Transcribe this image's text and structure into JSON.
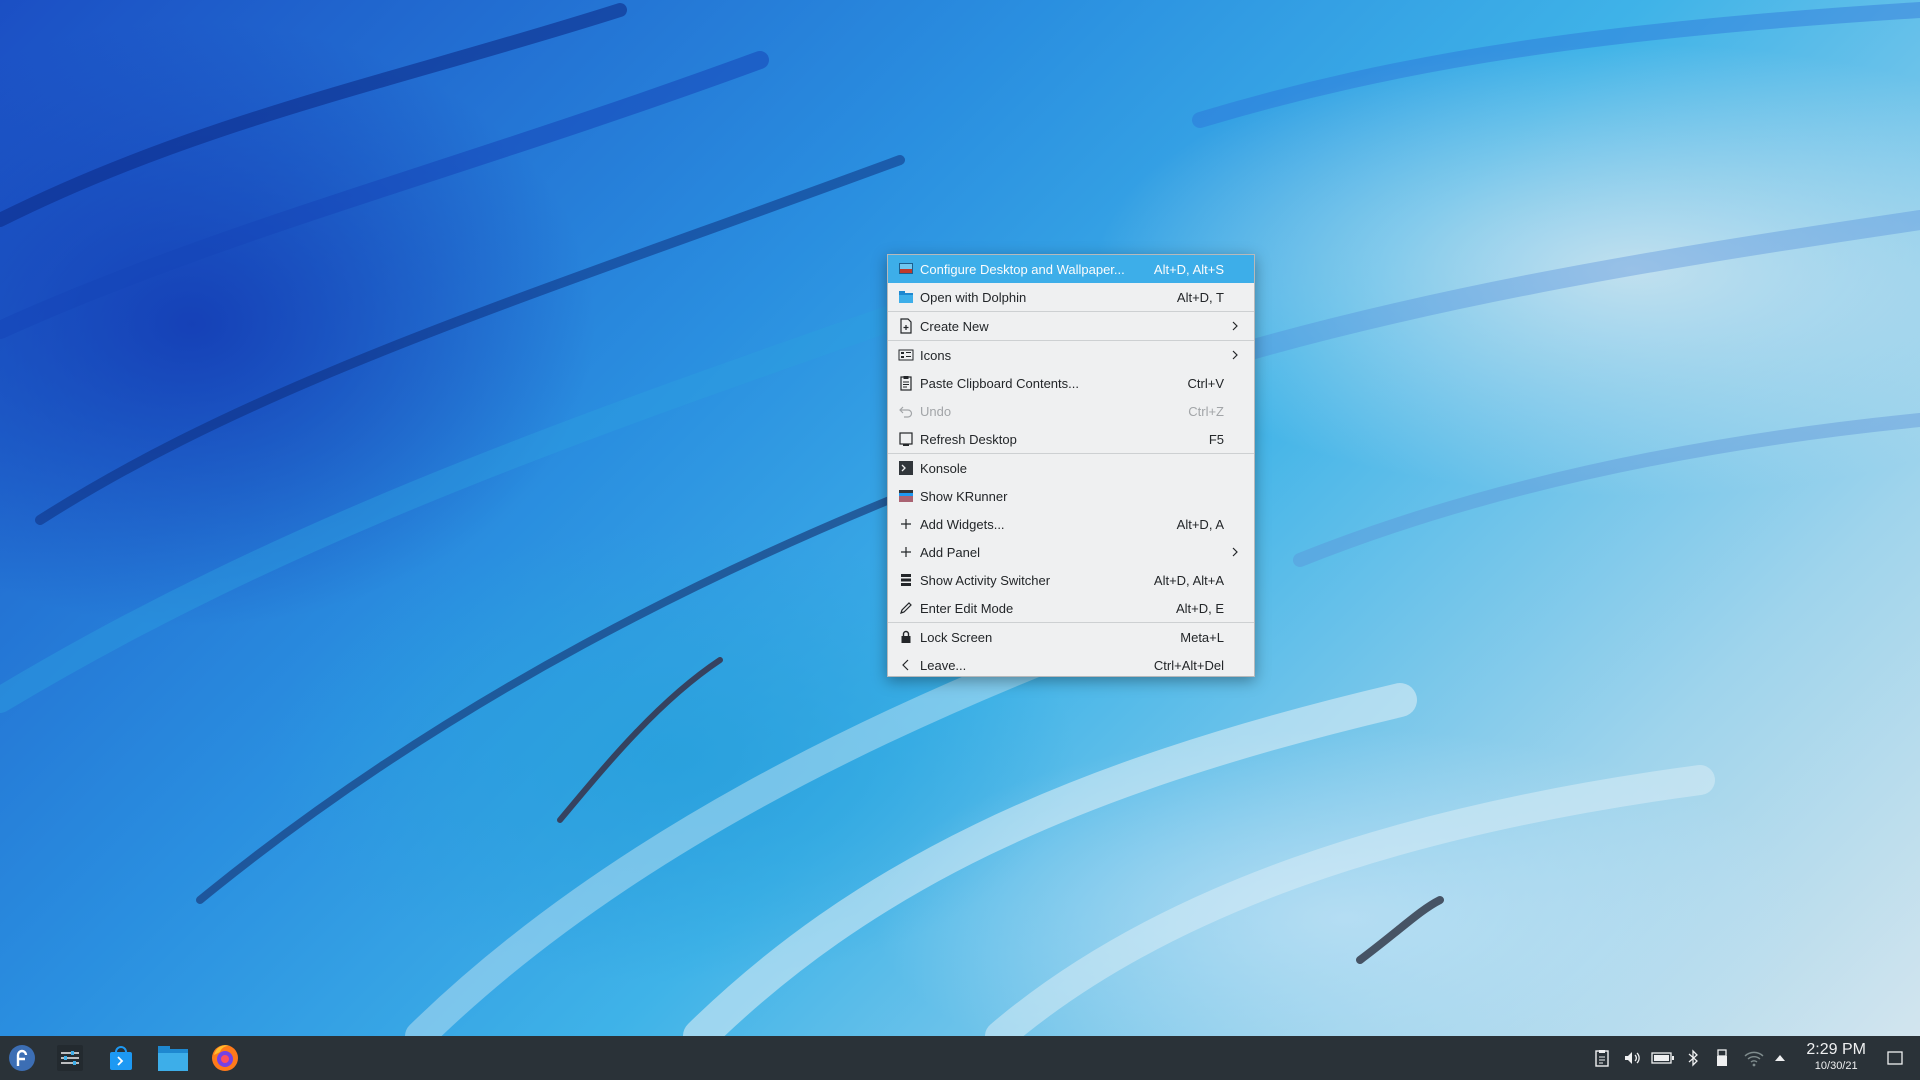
{
  "menu": {
    "items": [
      {
        "label": "Configure Desktop and Wallpaper...",
        "shortcut": "Alt+D, Alt+S",
        "icon": "desktop-config-icon"
      },
      {
        "label": "Open with Dolphin",
        "shortcut": "Alt+D, T",
        "icon": "folder-icon"
      },
      {
        "label": "Create New",
        "shortcut": "",
        "icon": "new-document-icon"
      },
      {
        "label": "Icons",
        "shortcut": "",
        "icon": "icons-grid-icon"
      },
      {
        "label": "Paste Clipboard Contents...",
        "shortcut": "Ctrl+V",
        "icon": "clipboard-icon"
      },
      {
        "label": "Undo",
        "shortcut": "Ctrl+Z",
        "icon": "undo-icon"
      },
      {
        "label": "Refresh Desktop",
        "shortcut": "F5",
        "icon": "refresh-icon"
      },
      {
        "label": "Konsole",
        "shortcut": "",
        "icon": "terminal-icon"
      },
      {
        "label": "Show KRunner",
        "shortcut": "",
        "icon": "krunner-icon"
      },
      {
        "label": "Add Widgets...",
        "shortcut": "Alt+D, A",
        "icon": "plus-icon"
      },
      {
        "label": "Add Panel",
        "shortcut": "",
        "icon": "plus-icon"
      },
      {
        "label": "Show Activity Switcher",
        "shortcut": "Alt+D, Alt+A",
        "icon": "activities-icon"
      },
      {
        "label": "Enter Edit Mode",
        "shortcut": "Alt+D, E",
        "icon": "pencil-icon"
      },
      {
        "label": "Lock Screen",
        "shortcut": "Meta+L",
        "icon": "lock-icon"
      },
      {
        "label": "Leave...",
        "shortcut": "Ctrl+Alt+Del",
        "icon": "chevron-left-icon"
      }
    ]
  },
  "taskbar": {
    "launchers": [
      "fedora-logo-icon",
      "system-settings-icon",
      "discover-store-icon",
      "dolphin-folder-icon",
      "firefox-icon"
    ],
    "tray": [
      "clipboard-icon",
      "volume-icon",
      "battery-icon",
      "bluetooth-icon",
      "usb-device-icon",
      "wifi-icon",
      "expand-tray-icon"
    ],
    "clock": {
      "time": "2:29 PM",
      "date": "10/30/21"
    }
  },
  "colors": {
    "highlight": "#3daee9",
    "menu_bg": "#eff0f1",
    "panel_bg": "#2a3238"
  }
}
